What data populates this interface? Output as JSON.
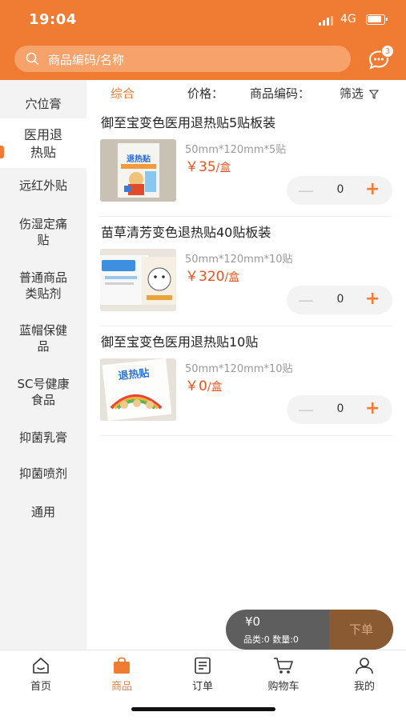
{
  "status": {
    "time": "19:04",
    "network": "4G"
  },
  "search": {
    "placeholder": "商品编码/名称"
  },
  "messages": {
    "badge": "3"
  },
  "sidebar": {
    "items": [
      {
        "label": "穴位膏"
      },
      {
        "label": "医用退\n热贴",
        "active": true
      },
      {
        "label": "远红外贴"
      },
      {
        "label": "伤湿定痛\n贴"
      },
      {
        "label": "普通商品\n类贴剂"
      },
      {
        "label": "蓝帽保健\n品"
      },
      {
        "label": "SC号健康\n食品"
      },
      {
        "label": "抑菌乳膏"
      },
      {
        "label": "抑菌喷剂"
      },
      {
        "label": "通用"
      }
    ]
  },
  "sortbar": {
    "general": "综合",
    "price": "价格：",
    "code": "商品编码：",
    "filter": "筛选"
  },
  "products": [
    {
      "name": "御至宝变色医用退热贴5贴板装",
      "spec": "50mm*120mm*5贴",
      "price": "￥35",
      "unit": "/盒",
      "qty": "0",
      "minus": "—",
      "plus": "+"
    },
    {
      "name": "苗草清芳变色退热贴40贴板装",
      "spec": "50mm*120mm*10贴",
      "price": "￥320",
      "unit": "/盒",
      "qty": "0",
      "minus": "—",
      "plus": "+"
    },
    {
      "name": "御至宝变色医用退热贴10贴",
      "spec": "50mm*120mm*10贴",
      "price": "￥0",
      "unit": "/盒",
      "qty": "0",
      "minus": "—",
      "plus": "+"
    }
  ],
  "cart": {
    "amount": "¥0",
    "summary": "品类:0  数量:0",
    "order_label": "下单"
  },
  "tabs": [
    {
      "label": "首页"
    },
    {
      "label": "商品",
      "active": true
    },
    {
      "label": "订单"
    },
    {
      "label": "购物车"
    },
    {
      "label": "我的"
    }
  ],
  "colors": {
    "accent": "#f07c33",
    "price": "#e8541e"
  }
}
